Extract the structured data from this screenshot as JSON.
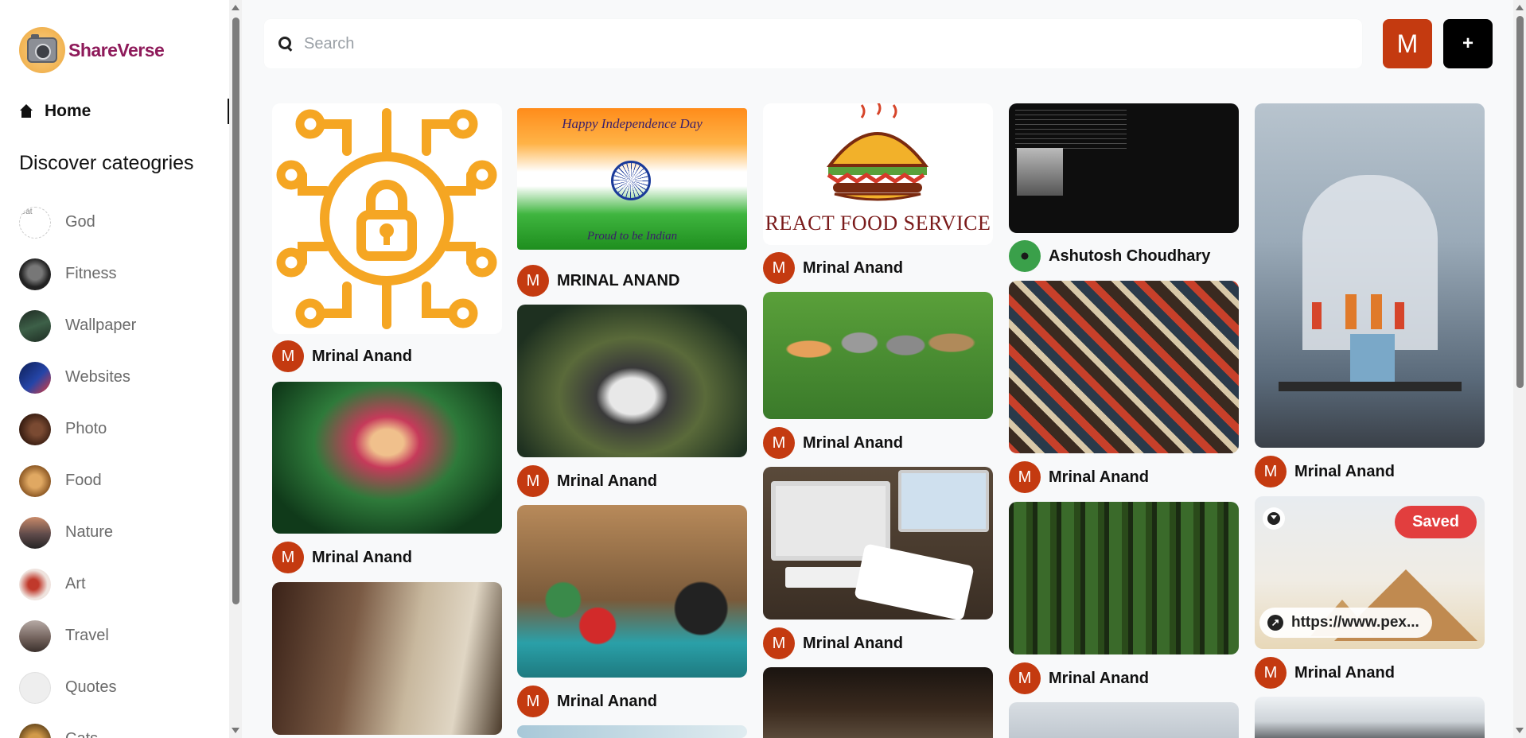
{
  "app": {
    "name": "ShareVerse"
  },
  "sidebar": {
    "home_label": "Home",
    "discover_title": "Discover cateogries",
    "categories": [
      {
        "label": "God",
        "color": "#e9e9e9"
      },
      {
        "label": "Fitness",
        "color": "#2b2b2b"
      },
      {
        "label": "Wallpaper",
        "color": "#2f4a3a"
      },
      {
        "label": "Websites",
        "color": "#1b2f6b"
      },
      {
        "label": "Photo",
        "color": "#4a2a1e"
      },
      {
        "label": "Food",
        "color": "#b87938"
      },
      {
        "label": "Nature",
        "color": "#7a5a4c"
      },
      {
        "label": "Art",
        "color": "#e8d6d2"
      },
      {
        "label": "Travel",
        "color": "#8a7c76"
      },
      {
        "label": "Quotes",
        "color": "#ececec"
      },
      {
        "label": "Cats",
        "color": "#a8742a"
      }
    ]
  },
  "search": {
    "placeholder": "Search"
  },
  "header": {
    "user_initial": "M",
    "add_label": "+"
  },
  "pins": {
    "author_default": "Mrinal Anand",
    "author_initial": "M",
    "names": {
      "p1": "Mrinal Anand",
      "p2": "Mrinal Anand",
      "p3": "MRINAL ANAND",
      "p4": "Mrinal Anand",
      "p5": "Mrinal Anand",
      "p6": "Mrinal Anand",
      "p7": "Mrinal Anand",
      "p8": "Mrinal Anand",
      "p9": "Ashutosh Choudhary",
      "p10": "Mrinal Anand",
      "p11": "Mrinal Anand",
      "p12": "Mrinal Anand",
      "p13": "Mrinal Anand"
    },
    "independence_title": "Happy Independence Day",
    "independence_sub": "Proud to be Indian",
    "food_service_label": "REACT FOOD SERVICE",
    "saved_label": "Saved",
    "url_text": "https://www.pex..."
  },
  "colors": {
    "brand": "#8e1a5a",
    "avatar": "#c43a10",
    "saved": "#e23e3e",
    "lock_orange": "#f5a623"
  }
}
